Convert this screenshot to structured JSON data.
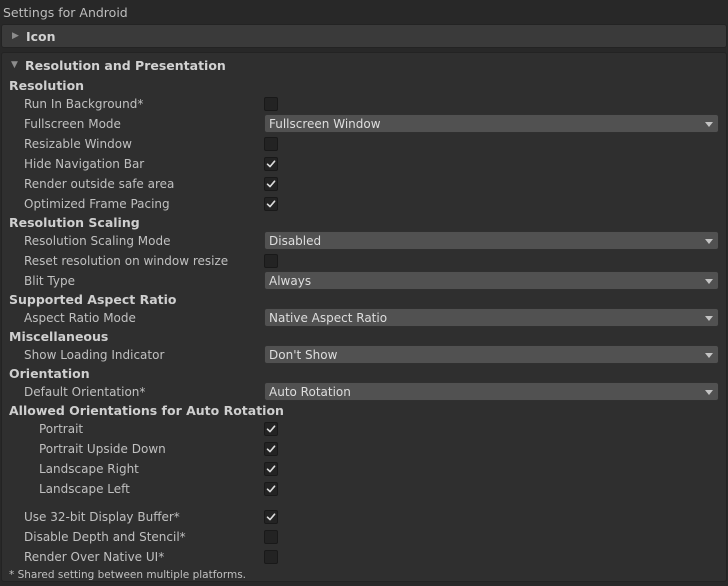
{
  "window": {
    "title": "Settings for Android"
  },
  "foldouts": {
    "icon": {
      "label": "Icon"
    },
    "resolution_presentation": {
      "label": "Resolution and Presentation"
    }
  },
  "sections": {
    "resolution": "Resolution",
    "resolution_scaling": "Resolution Scaling",
    "supported_aspect_ratio": "Supported Aspect Ratio",
    "miscellaneous": "Miscellaneous",
    "orientation": "Orientation",
    "allowed_orientations": "Allowed Orientations for Auto Rotation"
  },
  "settings": {
    "run_in_background": {
      "label": "Run In Background*",
      "checked": false
    },
    "fullscreen_mode": {
      "label": "Fullscreen Mode",
      "value": "Fullscreen Window"
    },
    "resizable_window": {
      "label": "Resizable Window",
      "checked": false
    },
    "hide_navigation_bar": {
      "label": "Hide Navigation Bar",
      "checked": true
    },
    "render_outside_safe_area": {
      "label": "Render outside safe area",
      "checked": true
    },
    "optimized_frame_pacing": {
      "label": "Optimized Frame Pacing",
      "checked": true
    },
    "resolution_scaling_mode": {
      "label": "Resolution Scaling Mode",
      "value": "Disabled"
    },
    "reset_resolution_on_resize": {
      "label": "Reset resolution on window resize",
      "checked": false
    },
    "blit_type": {
      "label": "Blit Type",
      "value": "Always"
    },
    "aspect_ratio_mode": {
      "label": "Aspect Ratio Mode",
      "value": "Native Aspect Ratio"
    },
    "show_loading_indicator": {
      "label": "Show Loading Indicator",
      "value": "Don't Show"
    },
    "default_orientation": {
      "label": "Default Orientation*",
      "value": "Auto Rotation"
    },
    "portrait": {
      "label": "Portrait",
      "checked": true
    },
    "portrait_upside_down": {
      "label": "Portrait Upside Down",
      "checked": true
    },
    "landscape_right": {
      "label": "Landscape Right",
      "checked": true
    },
    "landscape_left": {
      "label": "Landscape Left",
      "checked": true
    },
    "use_32bit_display_buffer": {
      "label": "Use 32-bit Display Buffer*",
      "checked": true
    },
    "disable_depth_stencil": {
      "label": "Disable Depth and Stencil*",
      "checked": false
    },
    "render_over_native_ui": {
      "label": "Render Over Native UI*",
      "checked": false
    }
  },
  "footnote": "* Shared setting between multiple platforms.",
  "icons": {
    "collapsed": "triangle-right-icon",
    "expanded": "triangle-down-icon",
    "check": "checkmark-icon",
    "dropdown": "chevron-down-icon"
  }
}
